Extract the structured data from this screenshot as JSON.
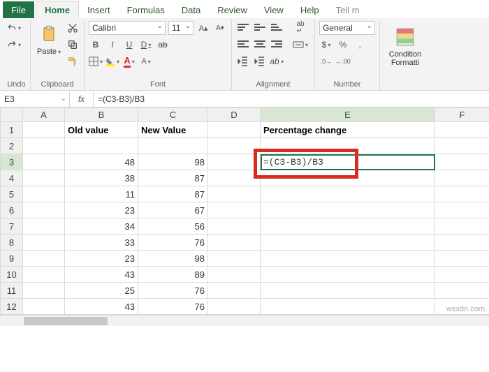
{
  "tabs": {
    "file": "File",
    "home": "Home",
    "insert": "Insert",
    "formulas": "Formulas",
    "data": "Data",
    "review": "Review",
    "view": "View",
    "help": "Help",
    "tellme": "Tell m"
  },
  "ribbon": {
    "undo_label": "Undo",
    "clipboard_label": "Clipboard",
    "paste_label": "Paste",
    "font_label": "Font",
    "alignment_label": "Alignment",
    "number_label": "Number",
    "font_name": "Calibri",
    "font_size": "11",
    "wrap_label": "ab",
    "number_format": "General",
    "currency_sym": "$",
    "percent_sym": "%",
    "comma_sym": ",",
    "dec_inc": ".0",
    "dec_dec": ".00",
    "cond_format": "Condition\nFormatti"
  },
  "cell_ref": "E3",
  "fx_glyph": "fx",
  "formula": "=(C3-B3)/B3",
  "columns": [
    "A",
    "B",
    "C",
    "D",
    "E",
    "F"
  ],
  "headers": {
    "B": "Old value",
    "C": "New Value",
    "E": "Percentage change"
  },
  "rows": [
    {
      "n": 1,
      "B": "Old value",
      "C": "New Value",
      "E": "Percentage change",
      "hdr": true
    },
    {
      "n": 2
    },
    {
      "n": 3,
      "B": "48",
      "C": "98",
      "E": "=(C3-B3)/B3",
      "edit": true
    },
    {
      "n": 4,
      "B": "38",
      "C": "87"
    },
    {
      "n": 5,
      "B": "11",
      "C": "87"
    },
    {
      "n": 6,
      "B": "23",
      "C": "67"
    },
    {
      "n": 7,
      "B": "34",
      "C": "56"
    },
    {
      "n": 8,
      "B": "33",
      "C": "76"
    },
    {
      "n": 9,
      "B": "23",
      "C": "98"
    },
    {
      "n": 10,
      "B": "43",
      "C": "89"
    },
    {
      "n": 11,
      "B": "25",
      "C": "76"
    },
    {
      "n": 12,
      "B": "43",
      "C": "76"
    }
  ],
  "watermark": "wsxdn.com"
}
